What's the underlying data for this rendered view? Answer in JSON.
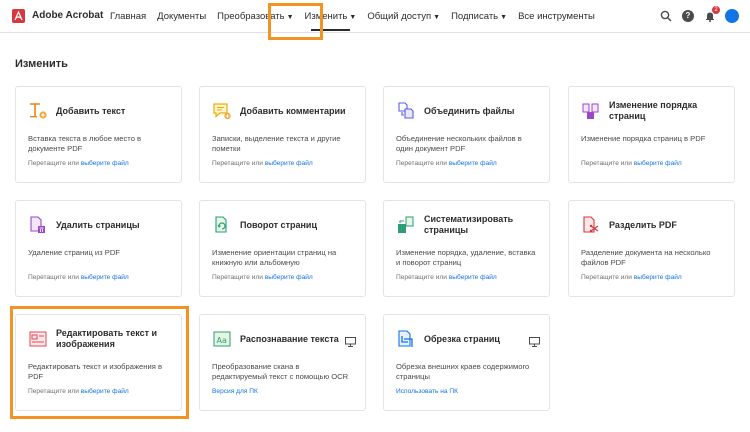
{
  "header": {
    "app_name": "Adobe Acrobat",
    "nav": [
      {
        "label": "Главная",
        "has_menu": false
      },
      {
        "label": "Документы",
        "has_menu": false
      },
      {
        "label": "Преобразовать",
        "has_menu": true
      },
      {
        "label": "Изменить",
        "has_menu": true,
        "active": true
      },
      {
        "label": "Общий доступ",
        "has_menu": true
      },
      {
        "label": "Подписать",
        "has_menu": true
      },
      {
        "label": "Все инструменты",
        "has_menu": false
      }
    ],
    "icons": [
      "search-icon",
      "help-icon",
      "notifications-icon",
      "avatar"
    ],
    "help_glyph": "?",
    "notifications_count": "2"
  },
  "section_title": "Изменить",
  "colors": {
    "accent": "#1473e6",
    "highlight": "#f29423",
    "brand": "#d7373f"
  },
  "cards": [
    {
      "title": "Добавить текст",
      "desc": "Вставка текста в любое место в документе PDF",
      "foot_text": "Перетащите или",
      "foot_link": "выберите файл",
      "icon": "add-text-icon"
    },
    {
      "title": "Добавить комментарии",
      "desc": "Записки, выделение текста и другие пометки",
      "foot_text": "Перетащите или",
      "foot_link": "выберите файл",
      "icon": "comment-icon"
    },
    {
      "title": "Объединить файлы",
      "desc": "Объединение нескольких файлов в один документ PDF",
      "foot_text": "Перетащите или",
      "foot_link": "выберите файл",
      "icon": "combine-files-icon"
    },
    {
      "title": "Изменение порядка страниц",
      "desc": "Изменение порядка страниц в PDF",
      "foot_text": "Перетащите или",
      "foot_link": "выберите файл",
      "icon": "reorder-pages-icon"
    },
    {
      "title": "Удалить страницы",
      "desc": "Удаление страниц из PDF",
      "foot_text": "Перетащите или",
      "foot_link": "выберите файл",
      "icon": "delete-pages-icon"
    },
    {
      "title": "Поворот страниц",
      "desc": "Изменение ориентации страниц на книжную или альбомную",
      "foot_text": "Перетащите или",
      "foot_link": "выберите файл",
      "icon": "rotate-pages-icon"
    },
    {
      "title": "Систематизировать страницы",
      "desc": "Изменение порядка, удаление, вставка и поворот страниц",
      "foot_text": "Перетащите или",
      "foot_link": "выберите файл",
      "icon": "organize-pages-icon"
    },
    {
      "title": "Разделить PDF",
      "desc": "Разделение документа на несколько файлов PDF",
      "foot_text": "Перетащите или",
      "foot_link": "выберите файл",
      "icon": "split-pdf-icon"
    },
    {
      "title": "Редактировать текст и изображения",
      "desc": "Редактировать текст и изображения в PDF",
      "foot_text": "Перетащите или",
      "foot_link": "выберите файл",
      "icon": "edit-text-images-icon"
    },
    {
      "title": "Распознавание текста",
      "desc": "Преобразование скана в редактируемый текст с помощью OCR",
      "foot_text": "",
      "foot_link": "Версия для ПК",
      "icon": "ocr-icon",
      "desktop_only": true
    },
    {
      "title": "Обрезка страниц",
      "desc": "Обрезка внешних краев содержимого страницы",
      "foot_text": "",
      "foot_link": "Использовать на ПК",
      "icon": "crop-pages-icon",
      "desktop_only": true
    }
  ]
}
